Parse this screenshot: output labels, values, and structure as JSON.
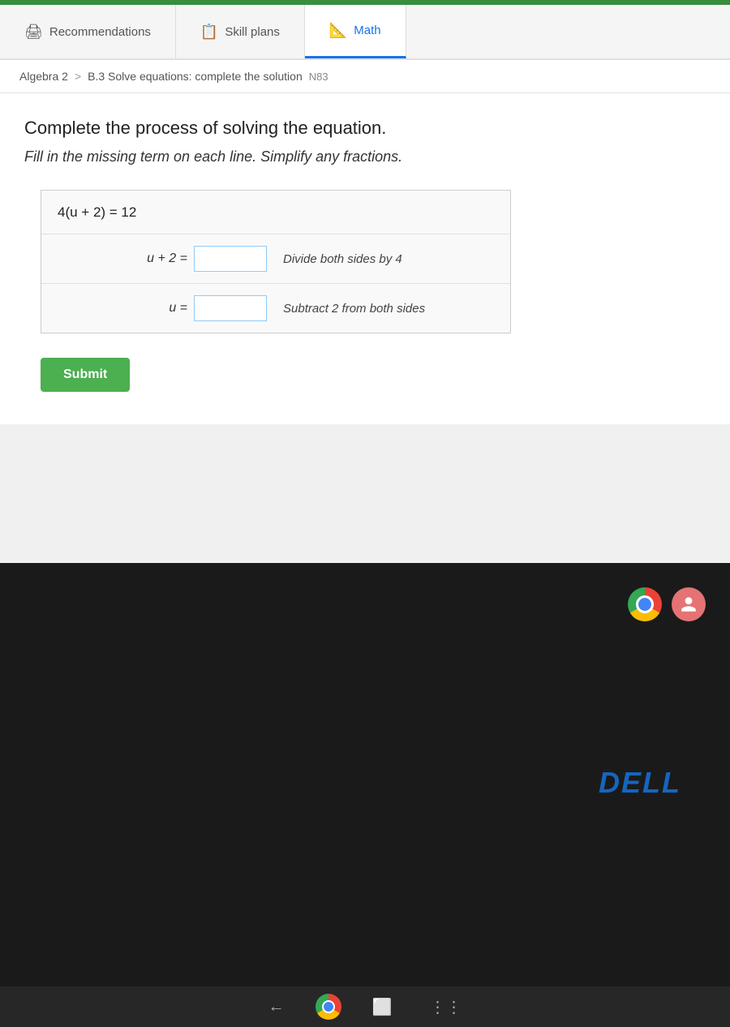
{
  "topbar": {
    "green_stripe_color": "#388e3c"
  },
  "tabs": {
    "items": [
      {
        "id": "recommendations",
        "label": "Recommendations",
        "icon": "🖨",
        "active": false
      },
      {
        "id": "skill-plans",
        "label": "Skill plans",
        "icon": "📋",
        "active": false
      },
      {
        "id": "math",
        "label": "Math",
        "icon": "📐",
        "active": true
      }
    ]
  },
  "breadcrumb": {
    "parent": "Algebra 2",
    "separator": ">",
    "current": "B.3 Solve equations: complete the solution",
    "tag": "N83"
  },
  "problem": {
    "title": "Complete the process of solving the equation.",
    "subtitle": "Fill in the missing term on each line. Simplify any fractions.",
    "equation_rows": [
      {
        "id": "row1",
        "lhs": "4(u + 2) = 12",
        "has_input": false,
        "hint": ""
      },
      {
        "id": "row2",
        "lhs": "u + 2 =",
        "has_input": true,
        "hint": "Divide both sides by 4",
        "input_value": ""
      },
      {
        "id": "row3",
        "lhs": "u =",
        "has_input": true,
        "hint": "Subtract 2 from both sides",
        "input_value": ""
      }
    ],
    "submit_label": "Submit"
  },
  "taskbar": {
    "dell_logo": "DELL"
  }
}
